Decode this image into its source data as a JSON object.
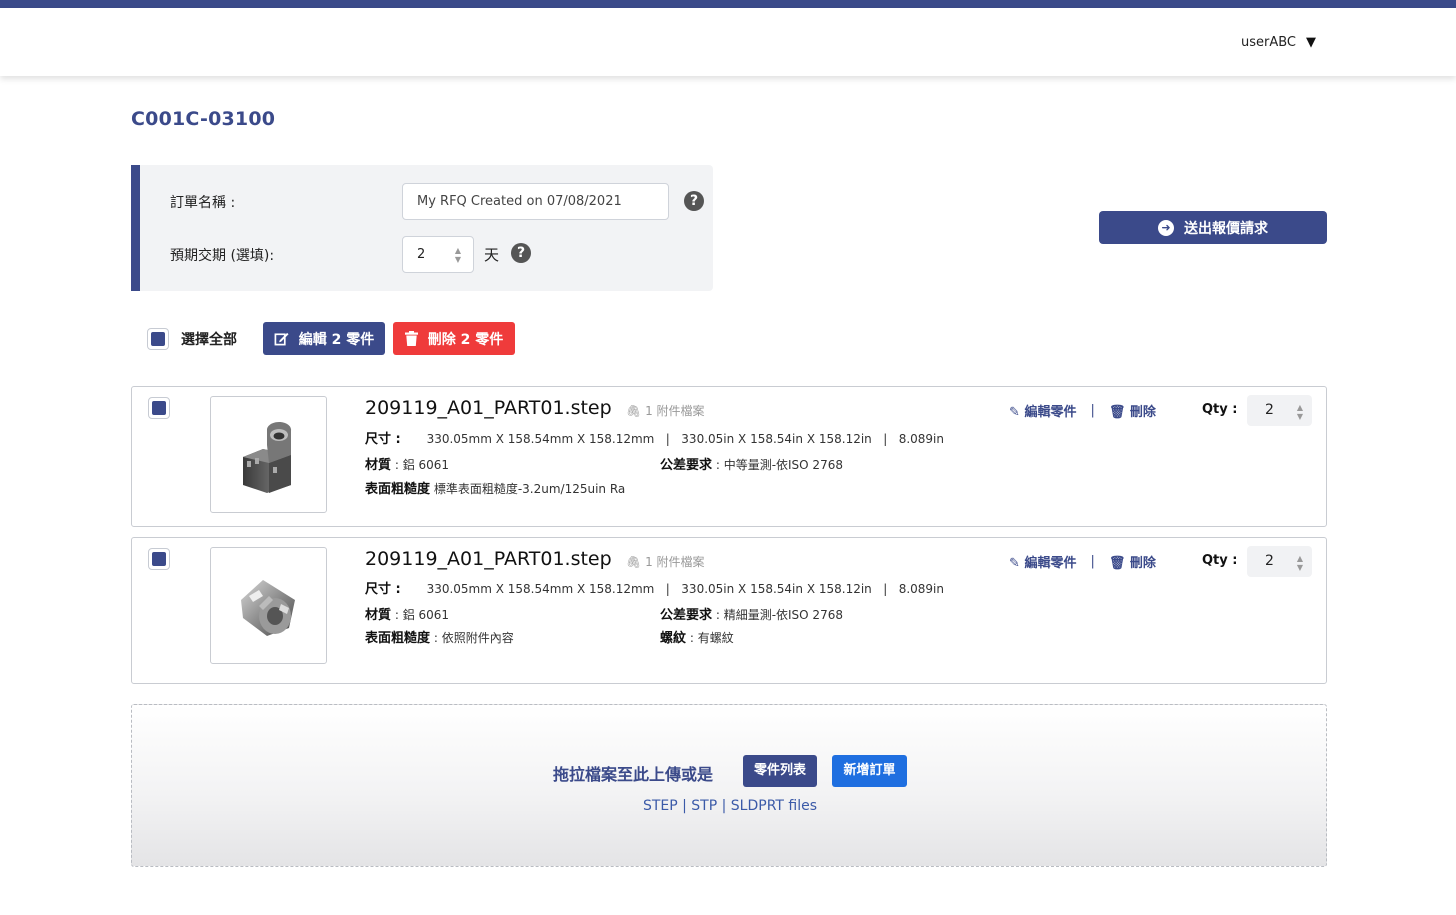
{
  "header": {
    "username": "userABC"
  },
  "rfq_id": "C001C-03100",
  "order": {
    "name_label": "訂單名稱 :",
    "name_value": "My RFQ Created on 07/08/2021",
    "lead_label": "預期交期 (選填):",
    "lead_value": "2",
    "lead_unit": "天"
  },
  "submit_label": "送出報價請求",
  "bulk": {
    "select_all_label": "選擇全部",
    "edit_label": "編輯 2 零件",
    "delete_label": "刪除 2 零件"
  },
  "parts": [
    {
      "filename": "209119_A01_PART01.step",
      "attachments": "1 附件檔案",
      "size_label": "尺寸 :",
      "size_value": "330.05mm X 158.54mm X 158.12mm   |   330.05in X 158.54in X 158.12in   |   8.089in",
      "material_label": "材質",
      "material_value": " : 鋁 6061",
      "tolerance_label": "公差要求",
      "tolerance_value": " : 中等量測-依ISO 2768",
      "roughness_label": "表面粗糙度",
      "roughness_value": " 標準表面粗糙度-3.2um/125uin Ra",
      "edit_label": "編輯零件",
      "delete_label": "刪除",
      "qty_label": "Qty :",
      "qty_value": "2"
    },
    {
      "filename": "209119_A01_PART01.step",
      "attachments": "1 附件檔案",
      "size_label": "尺寸 :",
      "size_value": "330.05mm X 158.54mm X 158.12mm   |   330.05in X 158.54in X 158.12in   |   8.089in",
      "material_label": "材質",
      "material_value": " : 鋁 6061",
      "tolerance_label": "公差要求",
      "tolerance_value": " : 精細量測-依ISO 2768",
      "roughness_label": "表面粗糙度",
      "roughness_value": " : 依照附件內容",
      "thread_label": "螺紋",
      "thread_value": " : 有螺紋",
      "edit_label": "編輯零件",
      "delete_label": "刪除",
      "qty_label": "Qty :",
      "qty_value": "2"
    }
  ],
  "dropzone": {
    "text": "拖拉檔案至此上傳或是",
    "parts_list_button": "零件列表",
    "new_order_button": "新增訂單",
    "file_types": "STEP | STP | SLDPRT  files"
  },
  "colors": {
    "primary": "#3b4a8a",
    "danger": "#ef3b3b",
    "link_blue": "#1f6fe0"
  }
}
